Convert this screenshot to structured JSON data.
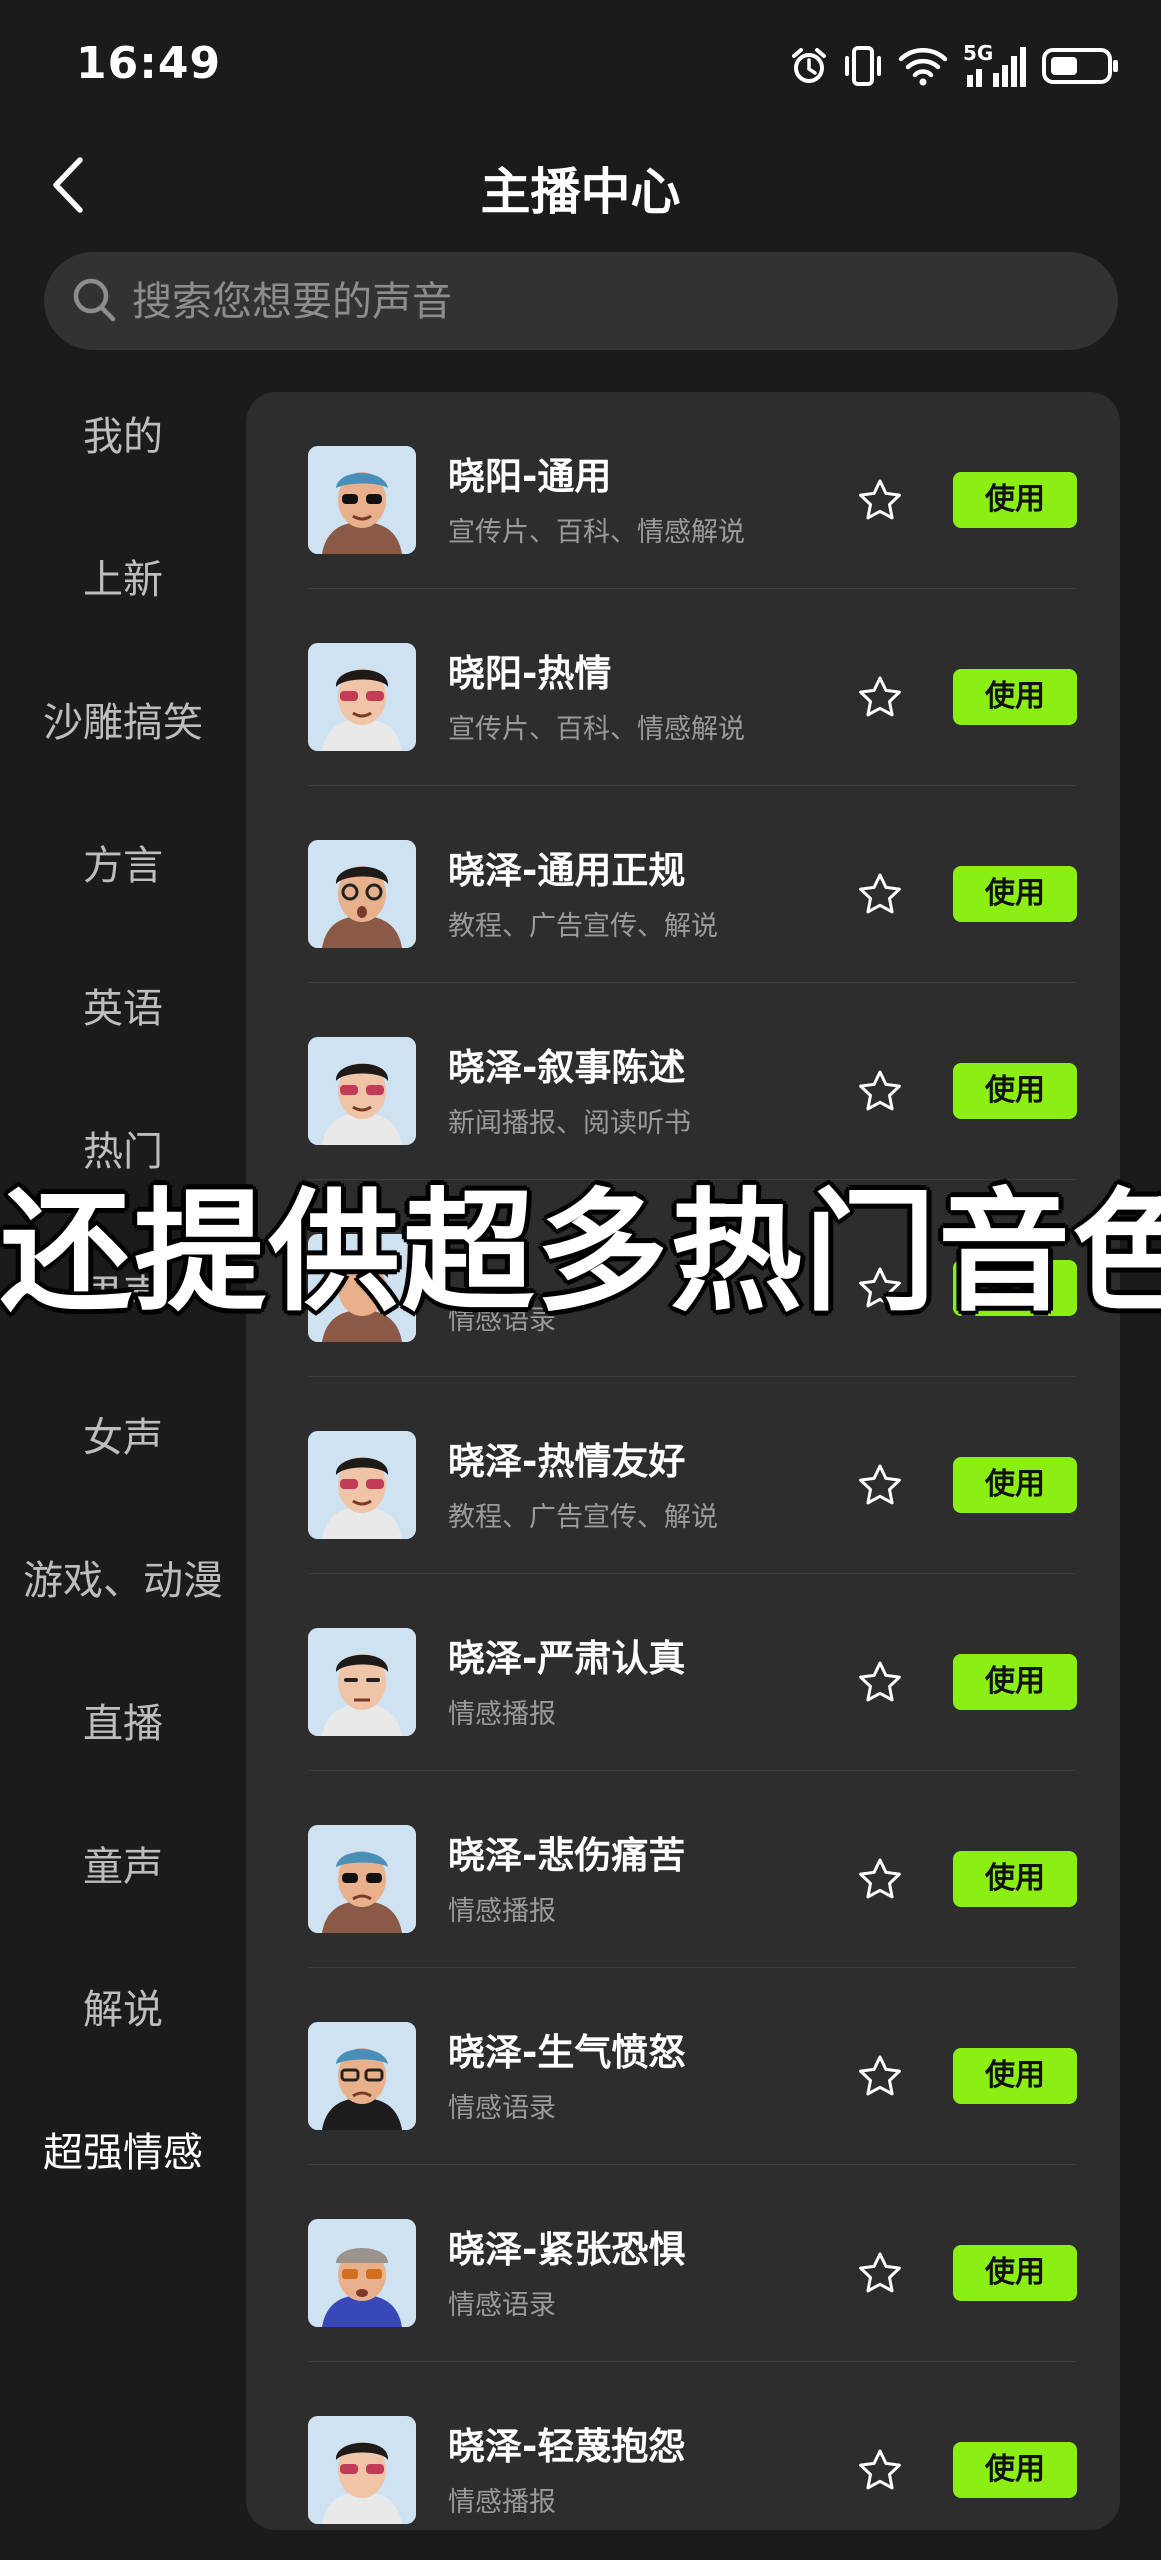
{
  "status_bar": {
    "time": "16:49",
    "network": "5G",
    "icons": [
      "alarm-icon",
      "vibrate-icon",
      "wifi-icon",
      "cellular-signal-icon",
      "battery-icon"
    ]
  },
  "header": {
    "title": "主播中心",
    "back_icon": "chevron-left-icon"
  },
  "search": {
    "placeholder": "搜索您想要的声音",
    "value": ""
  },
  "sidebar": {
    "active_index": 12,
    "items": [
      {
        "label": "我的"
      },
      {
        "label": "上新"
      },
      {
        "label": "沙雕搞笑"
      },
      {
        "label": "方言"
      },
      {
        "label": "英语"
      },
      {
        "label": "热门"
      },
      {
        "label": "男声"
      },
      {
        "label": "女声"
      },
      {
        "label": "游戏、动漫"
      },
      {
        "label": "直播"
      },
      {
        "label": "童声"
      },
      {
        "label": "解说"
      },
      {
        "label": "超强情感"
      }
    ]
  },
  "voices": [
    {
      "name": "晓阳-通用",
      "desc": "宣传片、百科、情感解说",
      "use_label": "使用"
    },
    {
      "name": "晓阳-热情",
      "desc": "宣传片、百科、情感解说",
      "use_label": "使用"
    },
    {
      "name": "晓泽-通用正规",
      "desc": "教程、广告宣传、解说",
      "use_label": "使用"
    },
    {
      "name": "晓泽-叙事陈述",
      "desc": "新闻播报、阅读听书",
      "use_label": "使用"
    },
    {
      "name": "",
      "desc": "情感语录",
      "use_label": "使用"
    },
    {
      "name": "晓泽-热情友好",
      "desc": "教程、广告宣传、解说",
      "use_label": "使用"
    },
    {
      "name": "晓泽-严肃认真",
      "desc": "情感播报",
      "use_label": "使用"
    },
    {
      "name": "晓泽-悲伤痛苦",
      "desc": "情感播报",
      "use_label": "使用"
    },
    {
      "name": "晓泽-生气愤怒",
      "desc": "情感语录",
      "use_label": "使用"
    },
    {
      "name": "晓泽-紧张恐惧",
      "desc": "情感语录",
      "use_label": "使用"
    },
    {
      "name": "晓泽-轻蔑抱怨",
      "desc": "情感播报",
      "use_label": "使用"
    }
  ],
  "overlay_caption": "还提供超多热门音色",
  "colors": {
    "background": "#1b1b1b",
    "panel": "#2d2d2d",
    "accent_green": "#8cef14",
    "search_bg": "#323232"
  }
}
